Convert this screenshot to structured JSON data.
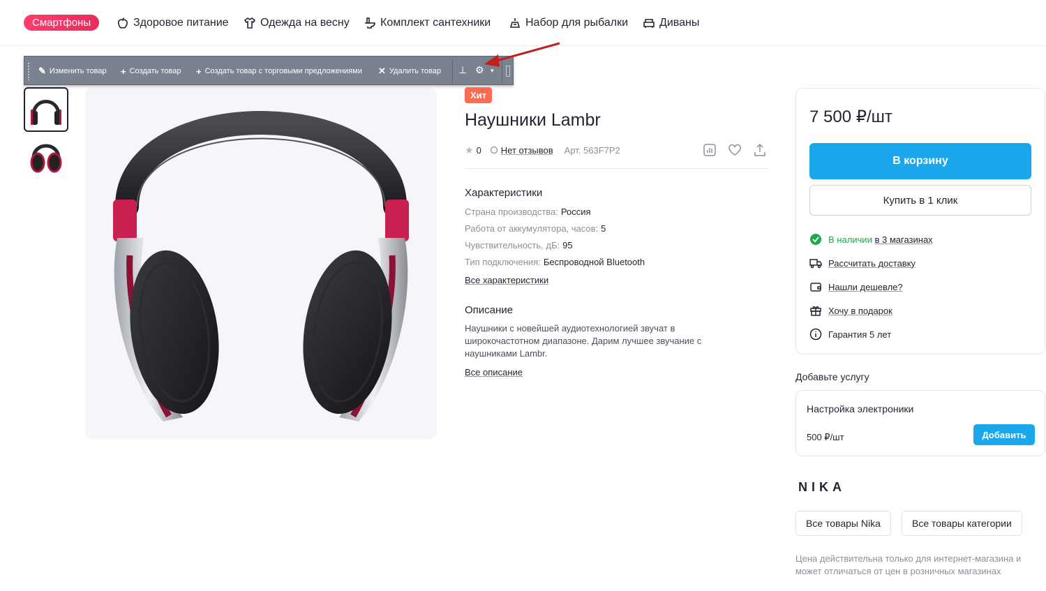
{
  "nav": {
    "pill": "Смартфоны",
    "items": [
      {
        "label": "Здоровое питание",
        "icon": "apple-icon"
      },
      {
        "label": "Одежда на весну",
        "icon": "shirt-icon"
      },
      {
        "label": "Комплект сантехники",
        "icon": "toilet-icon"
      },
      {
        "label": "Набор для рыбалки",
        "icon": "fishing-icon"
      },
      {
        "label": "Диваны",
        "icon": "sofa-icon"
      }
    ]
  },
  "admin_toolbar": {
    "edit": "Изменить товар",
    "create": "Создать товар",
    "create_offers": "Создать товар с торговыми предложениями",
    "delete": "Удалить товар",
    "pin_icon": "pin-icon",
    "settings_icon": "gear-icon"
  },
  "product": {
    "badge": "Хит",
    "title": "Наушники Lambr",
    "rating": "0",
    "reviews": "Нет отзывов",
    "article": "Арт. 563F7P2",
    "specs_title": "Характеристики",
    "specs": [
      {
        "k": "Страна производства:",
        "v": "Россия"
      },
      {
        "k": "Работа от аккумулятора, часов:",
        "v": "5"
      },
      {
        "k": "Чувствительность, дБ:",
        "v": "95"
      },
      {
        "k": "Тип подключения:",
        "v": "Беспроводной Bluetooth"
      }
    ],
    "all_specs": "Все характеристики",
    "desc_title": "Описание",
    "description": "Наушники с новейшей аудиотехнологией звучат в широкочастотном диапазоне. Дарим лучшее звучание с наушниками Lambr.",
    "all_desc": "Все описание"
  },
  "buy": {
    "price": "7 500 ₽/шт",
    "cart": "В корзину",
    "one_click": "Купить в 1 клик",
    "stock_status": "В наличии",
    "stock_where": "в 3 магазинах",
    "delivery": "Рассчитать доставку",
    "cheaper": "Нашли дешевле?",
    "gift": "Хочу в подарок",
    "warranty": "Гарантия 5 лет",
    "accent": "#1aa7ec",
    "green": "#1ca84b"
  },
  "service": {
    "title": "Добавьте услугу",
    "name": "Настройка электроники",
    "price": "500 ₽/шт",
    "add": "Добавить"
  },
  "brand": {
    "logo": "NIKA",
    "all_brand": "Все товары Nika",
    "all_category": "Все товары категории",
    "note": "Цена действительна только для интернет-магазина и может отличаться от цен в розничных магазинах"
  }
}
